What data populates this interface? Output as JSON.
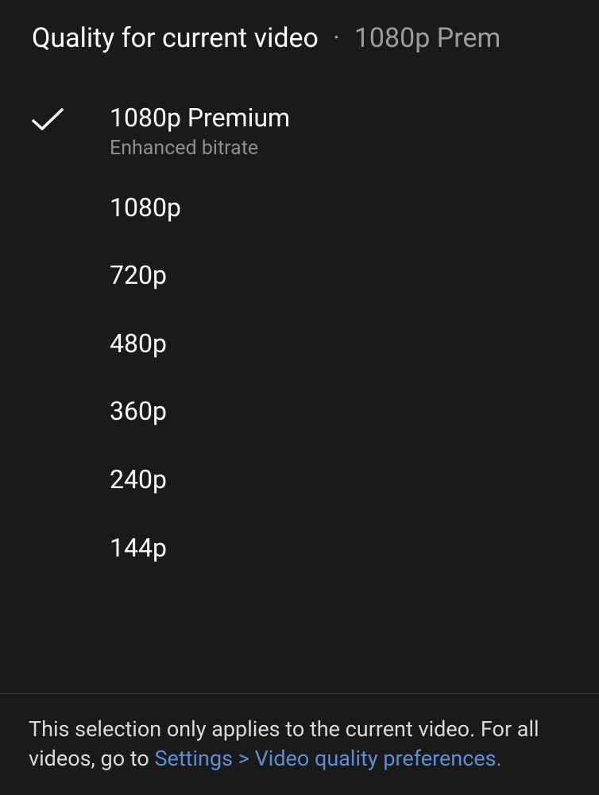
{
  "header": {
    "title": "Quality for current video",
    "separator": "·",
    "current": "1080p Prem"
  },
  "options": [
    {
      "label": "1080p Premium",
      "sublabel": "Enhanced bitrate",
      "selected": true
    },
    {
      "label": "1080p",
      "sublabel": null,
      "selected": false
    },
    {
      "label": "720p",
      "sublabel": null,
      "selected": false
    },
    {
      "label": "480p",
      "sublabel": null,
      "selected": false
    },
    {
      "label": "360p",
      "sublabel": null,
      "selected": false
    },
    {
      "label": "240p",
      "sublabel": null,
      "selected": false
    },
    {
      "label": "144p",
      "sublabel": null,
      "selected": false
    }
  ],
  "footer": {
    "prefix": "This selection only applies to the current video. For all videos, go to ",
    "link": "Settings > Video quality preferences."
  }
}
